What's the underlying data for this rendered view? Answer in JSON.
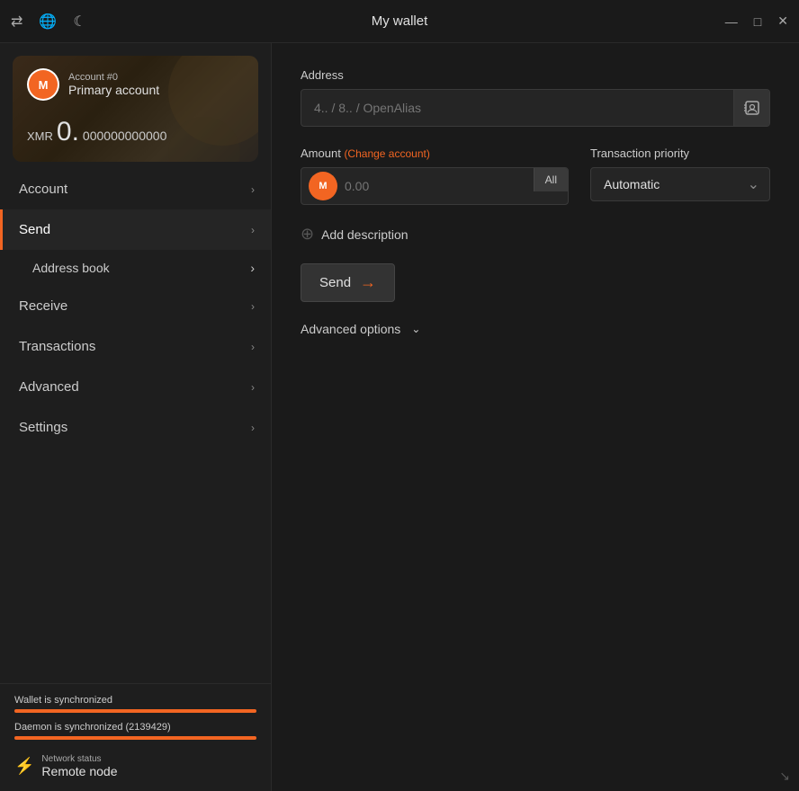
{
  "titlebar": {
    "title": "My wallet",
    "icon_transfer": "⇄",
    "icon_globe": "🌐",
    "icon_moon": "☾",
    "icon_minimize": "—",
    "icon_maximize": "□",
    "icon_close": "✕"
  },
  "sidebar": {
    "account_card": {
      "account_number": "Account #0",
      "account_name": "Primary account",
      "balance_currency": "XMR",
      "balance_whole": "0.",
      "balance_decimals": "000000000000"
    },
    "nav_items": [
      {
        "label": "Account",
        "id": "account",
        "active": false
      },
      {
        "label": "Send",
        "id": "send",
        "active": true
      },
      {
        "label": "Address book",
        "id": "address-book",
        "sub": true,
        "active": false
      },
      {
        "label": "Receive",
        "id": "receive",
        "active": false
      },
      {
        "label": "Transactions",
        "id": "transactions",
        "active": false
      },
      {
        "label": "Advanced",
        "id": "advanced",
        "active": false
      },
      {
        "label": "Settings",
        "id": "settings",
        "active": false
      }
    ],
    "sync": {
      "wallet_label": "Wallet is synchronized",
      "daemon_label": "Daemon is synchronized (2139429)",
      "wallet_progress": 100,
      "daemon_progress": 100
    },
    "network": {
      "status_label": "Network status",
      "status_value": "Remote node"
    }
  },
  "content": {
    "address_label": "Address",
    "address_placeholder": "4.. / 8.. / OpenAlias",
    "amount_label": "Amount",
    "change_account_label": "(Change account)",
    "amount_placeholder": "0.00",
    "all_button": "All",
    "priority_label": "Transaction priority",
    "priority_value": "Automatic",
    "add_description_label": "Add description",
    "send_button": "Send",
    "advanced_options_label": "Advanced options"
  }
}
